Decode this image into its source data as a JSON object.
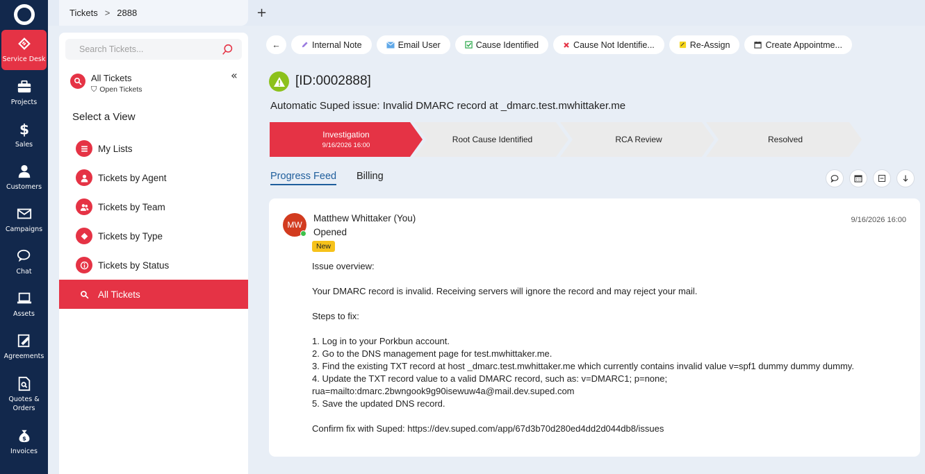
{
  "rail": {
    "items": [
      {
        "label": "Service Desk",
        "icon": "ticket-icon",
        "active": true
      },
      {
        "label": "Projects",
        "icon": "briefcase-icon"
      },
      {
        "label": "Sales",
        "icon": "dollar-icon"
      },
      {
        "label": "Customers",
        "icon": "user-icon"
      },
      {
        "label": "Campaigns",
        "icon": "envelope-icon"
      },
      {
        "label": "Chat",
        "icon": "chat-icon"
      },
      {
        "label": "Assets",
        "icon": "laptop-icon"
      },
      {
        "label": "Agreements",
        "icon": "signature-icon"
      },
      {
        "label_line1": "Quotes &",
        "label_line2": "Orders",
        "icon": "document-search-icon"
      },
      {
        "label": "Invoices",
        "icon": "money-bag-icon"
      }
    ]
  },
  "topbar": {
    "breadcrumb_root": "Tickets",
    "breadcrumb_separator": ">",
    "breadcrumb_current": "2888",
    "new_tab": "+"
  },
  "panel": {
    "search_placeholder": "Search Tickets...",
    "current_view": "All Tickets",
    "current_filter": "Open Tickets",
    "collapse": "«",
    "select_view": "Select a View",
    "menu": [
      {
        "label": "My Lists",
        "icon": "list-icon"
      },
      {
        "label": "Tickets by Agent",
        "icon": "person-icon"
      },
      {
        "label": "Tickets by Team",
        "icon": "team-icon"
      },
      {
        "label": "Tickets by Type",
        "icon": "tag-icon"
      },
      {
        "label": "Tickets by Status",
        "icon": "info-icon"
      },
      {
        "label": "All Tickets",
        "icon": "search-icon",
        "active": true
      }
    ]
  },
  "toolbar": {
    "back": "←",
    "internal_note": "Internal Note",
    "email_user": "Email User",
    "cause_identified": "Cause Identified",
    "cause_not_identified": "Cause Not Identifie...",
    "reassign": "Re-Assign",
    "create_appointment": "Create Appointme..."
  },
  "ticket": {
    "id": "[ID:0002888]",
    "title": "Automatic Suped issue: Invalid DMARC record at _dmarc.test.mwhittaker.me"
  },
  "pipeline": {
    "active_color": "#e53345",
    "inactive_color": "#ebebeb",
    "stages": [
      {
        "label": "Investigation",
        "date": "9/16/2026 16:00",
        "active": true
      },
      {
        "label": "Root Cause Identified"
      },
      {
        "label": "RCA Review"
      },
      {
        "label": "Resolved"
      }
    ]
  },
  "tabs": {
    "progress_feed": "Progress Feed",
    "billing": "Billing"
  },
  "feed": {
    "avatar_initials": "MW",
    "author": "Matthew Whittaker (You)",
    "action": "Opened",
    "badge": "New",
    "timestamp": "9/16/2026 16:00",
    "lines": [
      "Issue overview:",
      "",
      "Your DMARC record is invalid. Receiving servers will ignore the record and may reject your mail.",
      "",
      "Steps to fix:",
      "",
      "1. Log in to your Porkbun account.",
      "2. Go to the DNS management page for test.mwhittaker.me.",
      "3. Find the existing TXT record at host _dmarc.test.mwhittaker.me which currently contains invalid value v=spf1 dummy dummy dummy.",
      "4. Update the TXT record value to a valid DMARC record, such as: v=DMARC1; p=none;",
      "rua=mailto:dmarc.2bwngook9g90isewuw4a@mail.dev.suped.com",
      "5. Save the updated DNS record.",
      "",
      "Confirm fix with Suped: https://dev.suped.com/app/67d3b70d280ed4dd2d044db8/issues"
    ]
  },
  "colors": {
    "rail": "#12284c",
    "accent": "#e53345",
    "warn": "#8cc11c",
    "link": "#1f5e9c",
    "badge": "#f6c21a"
  }
}
